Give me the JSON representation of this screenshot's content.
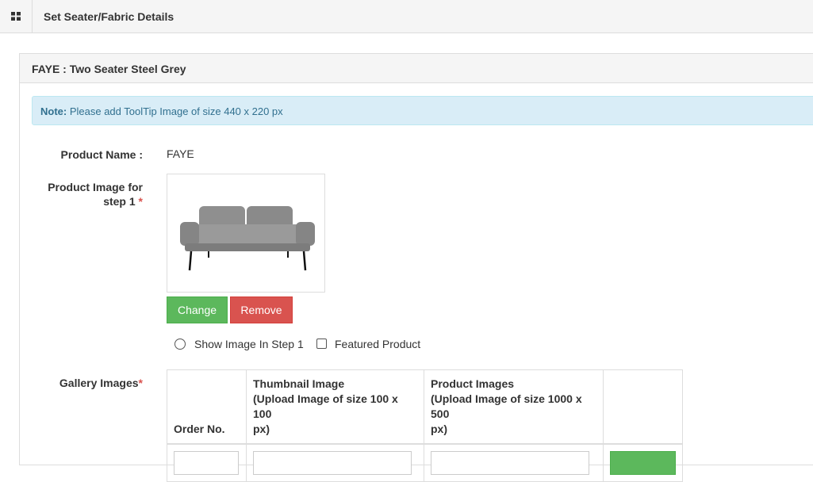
{
  "topbar": {
    "menu_icon": "grid-icon",
    "title": "Set Seater/Fabric Details"
  },
  "panel": {
    "title": "FAYE : Two Seater Steel Grey"
  },
  "note": {
    "prefix": "Note:",
    "text": " Please add ToolTip Image of size 440 x 220 px"
  },
  "form": {
    "product_name_label": "Product Name :",
    "product_name_value": "FAYE",
    "product_image_label_line1": "Product Image for",
    "product_image_label_line2": "step 1",
    "required_mark": "*",
    "product_image_icon": "sofa-image",
    "change_button": "Change",
    "remove_button": "Remove",
    "show_image_label": "Show Image In Step 1",
    "featured_label": "Featured Product",
    "gallery_label": "Gallery Images"
  },
  "gallery_table": {
    "headers": [
      {
        "line1": "",
        "line2": "",
        "line3": "Order No."
      },
      {
        "line1": "Thumbnail Image",
        "line2": "(Upload Image of size 100 x 100",
        "line3": "px)"
      },
      {
        "line1": "Product Images",
        "line2": "(Upload Image of size 1000 x 500",
        "line3": "px)"
      },
      {
        "line1": "",
        "line2": "",
        "line3": ""
      }
    ]
  }
}
